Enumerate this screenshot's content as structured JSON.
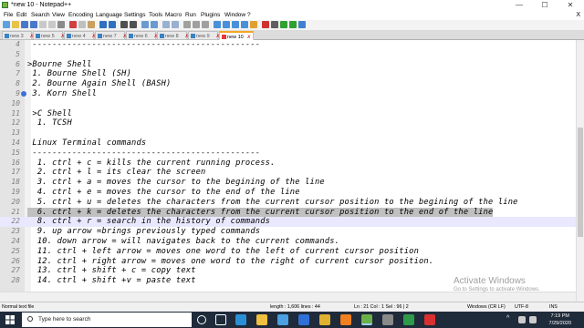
{
  "window": {
    "title": "*new 10 - Notepad++",
    "controls": [
      "—",
      "☐",
      "✕"
    ]
  },
  "menu": {
    "items": [
      "File",
      "Edit",
      "Search",
      "View",
      "Encoding",
      "Language",
      "Settings",
      "Tools",
      "Macro",
      "Run",
      "Plugins",
      "Window",
      "?"
    ],
    "close": "X"
  },
  "tabs": [
    {
      "label": "new 3"
    },
    {
      "label": "new 5"
    },
    {
      "label": "new 4"
    },
    {
      "label": "new 7"
    },
    {
      "label": "new 6"
    },
    {
      "label": "new 8"
    },
    {
      "label": "new 9"
    },
    {
      "label": "new 10",
      "active": true
    }
  ],
  "editor": {
    "lines": [
      {
        "num": "4",
        "text": " ----------------------------------------------"
      },
      {
        "num": "5",
        "text": ""
      },
      {
        "num": "6",
        "text": ">Bourne Shell"
      },
      {
        "num": "7",
        "text": " 1. Bourne Shell (SH)"
      },
      {
        "num": "8",
        "text": " 2. Bourne Again Shell (BASH)"
      },
      {
        "num": "9",
        "text": " 3. Korn Shell",
        "bookmark": true
      },
      {
        "num": "10",
        "text": ""
      },
      {
        "num": "11",
        "text": " >C Shell"
      },
      {
        "num": "12",
        "text": "  1. TCSH"
      },
      {
        "num": "13",
        "text": ""
      },
      {
        "num": "14",
        "text": " Linux Terminal commands"
      },
      {
        "num": "15",
        "text": " ----------------------------------------------"
      },
      {
        "num": "16",
        "text": "  1. ctrl + c = kills the current running process."
      },
      {
        "num": "17",
        "text": "  2. ctrl + l = its clear the screen"
      },
      {
        "num": "18",
        "text": "  3. ctrl + a = moves the cursor to the begining of the line"
      },
      {
        "num": "19",
        "text": "  4. ctrl + e = moves the cursor to the end of the line"
      },
      {
        "num": "20",
        "text": "  5. ctrl + u = deletes the characters from the current cursor position to the begining of the line"
      },
      {
        "num": "21",
        "text": "  6. ctrl + k = deletes the characters from the current cursor position to the end of the line",
        "selected": true
      },
      {
        "num": "22",
        "text": "  8. ctrl + r = search in the history of commands",
        "current": true
      },
      {
        "num": "23",
        "text": "  9. up arrow =brings previously typed commands"
      },
      {
        "num": "24",
        "text": "  10. down arrow = will navigates back to the current commands."
      },
      {
        "num": "25",
        "text": "  11. ctrl + left arrow = moves one word to the left of current cursor position"
      },
      {
        "num": "26",
        "text": "  12. ctrl + right arrow = moves one word to the right of current cursor position."
      },
      {
        "num": "27",
        "text": "  13. ctrl + shift + c = copy text"
      },
      {
        "num": "28",
        "text": "  14. ctrl + shift +v = paste text"
      }
    ]
  },
  "watermark": {
    "title": "Activate Windows",
    "subtitle": "Go to Settings to activate Windows."
  },
  "status": {
    "type": "Normal text file",
    "length": "length : 1,606   lines : 44",
    "position": "Ln : 21   Col : 1   Sel : 96 | 2",
    "eol": "Windows (CR LF)",
    "encoding": "UTF-8",
    "mode": "INS"
  },
  "taskbar": {
    "search_placeholder": "Type here to search",
    "time": "7:19 PM",
    "date": "7/29/2020"
  },
  "colors": {
    "accent_tab": "#f5a623",
    "bookmark": "#3d6fd6",
    "taskbar": "#1f2a3a"
  }
}
